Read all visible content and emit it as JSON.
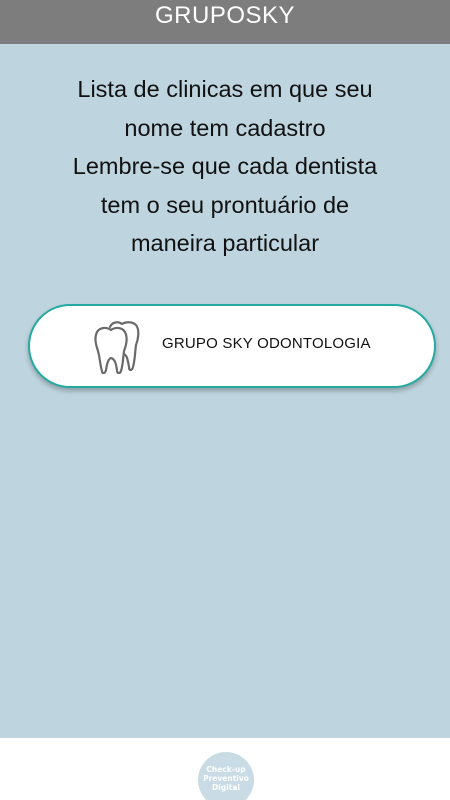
{
  "header": {
    "title": "GRUPOSKY"
  },
  "intro": {
    "lines": [
      "Lista de clinicas em que seu",
      "nome tem cadastro",
      "Lembre-se que cada dentista",
      "tem o seu prontuário de",
      "maneira particular"
    ]
  },
  "clinics": [
    {
      "name": "GRUPO SKY ODONTOLOGIA",
      "icon": "tooth-icon"
    }
  ],
  "footer": {
    "logo_lines": [
      "Check-up",
      "Preventivo",
      "Digital"
    ]
  },
  "colors": {
    "header_bg": "#7d7d7d",
    "page_bg": "#bed4de",
    "card_border": "#24aaa2",
    "footer_bg": "#ffffff"
  }
}
